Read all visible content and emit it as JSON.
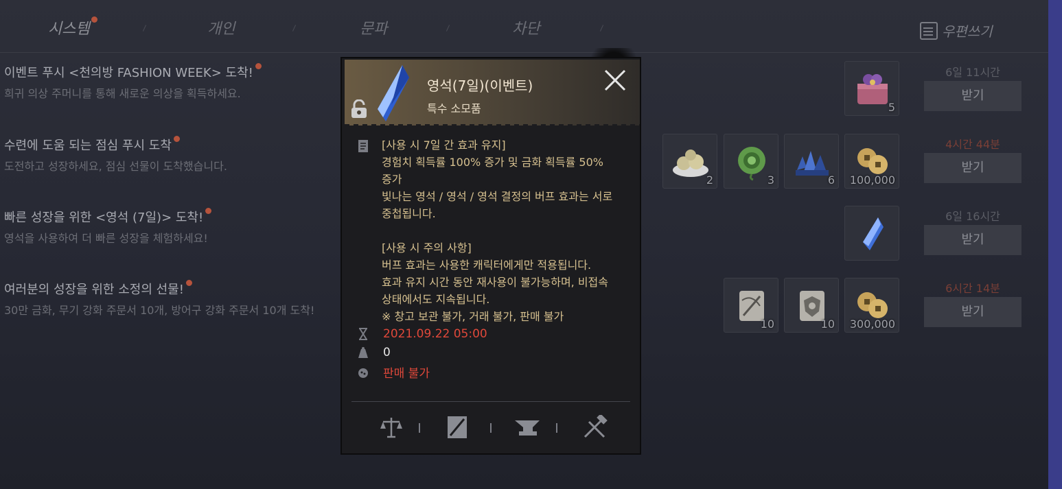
{
  "tabs": [
    {
      "label": "시스템",
      "active": true,
      "has_dot": true
    },
    {
      "label": "개인",
      "active": false
    },
    {
      "label": "문파",
      "active": false
    },
    {
      "label": "차단",
      "active": false
    }
  ],
  "write_button": {
    "label": "우편쓰기",
    "icon": "write-mail-icon"
  },
  "mails": [
    {
      "title": "이벤트 푸시 <천의방 FASHION WEEK> 도착!",
      "description": "희귀 의상 주머니를 통해 새로운 의상을 획득하세요.",
      "timer": "6일 11시간",
      "timer_urgent": false,
      "claim_label": "받기",
      "items": [
        {
          "icon": "gift-box-icon",
          "qty": "5"
        }
      ]
    },
    {
      "title": "수련에 도움 되는 점심 푸시 도착",
      "description": "도전하고 성장하세요, 점심 선물이 도착했습니다.",
      "timer": "4시간 44분",
      "timer_urgent": true,
      "claim_label": "받기",
      "items": [
        {
          "icon": "dumpling-plate-icon",
          "qty": "2"
        },
        {
          "icon": "green-jade-icon",
          "qty": "3"
        },
        {
          "icon": "blue-crystal-cluster-icon",
          "qty": "6"
        },
        {
          "icon": "gold-coins-icon",
          "qty": "100,000"
        }
      ]
    },
    {
      "title": "빠른 성장을 위한 <영석 (7일)> 도착!",
      "description": "영석을 사용하여 더 빠른 성장을 체험하세요!",
      "timer": "6일 16시간",
      "timer_urgent": false,
      "claim_label": "받기",
      "items": [
        {
          "icon": "spirit-stone-icon",
          "qty": ""
        }
      ]
    },
    {
      "title": "여러분의 성장을 위한 소정의 선물!",
      "description": "30만 금화, 무기 강화 주문서 10개, 방어구 강화 주문서 10개 도착!",
      "timer": "6시간 14분",
      "timer_urgent": true,
      "claim_label": "받기",
      "items": [
        {
          "icon": "weapon-scroll-icon",
          "qty": "10"
        },
        {
          "icon": "armor-scroll-icon",
          "qty": "10"
        },
        {
          "icon": "gold-coins-icon",
          "qty": "300,000"
        }
      ]
    }
  ],
  "tooltip": {
    "name": "영석(7일)(이벤트)",
    "type": "특수 소모품",
    "description_lines": [
      "[사용 시 7일 간 효과 유지]",
      "경험치 획득률 100% 증가 및 금화 획득률 50%",
      "증가",
      "빛나는 영석 / 영석 / 영석 결정의 버프 효과는 서로",
      "중첩됩니다.",
      "",
      "[사용 시 주의 사항]",
      "버프 효과는 사용한 캐릭터에게만 적용됩니다.",
      "효과 유지 시간 동안 재사용이 불가능하며, 비접속",
      "상태에서도 지속됩니다.",
      "※ 창고 보관 불가, 거래 불가, 판매 불가"
    ],
    "expiry": "2021.09.22 05:00",
    "weight": "0",
    "sell_status": "판매 불가",
    "colors": {
      "desc": "#d6c08f",
      "warning": "#e0483a"
    }
  }
}
